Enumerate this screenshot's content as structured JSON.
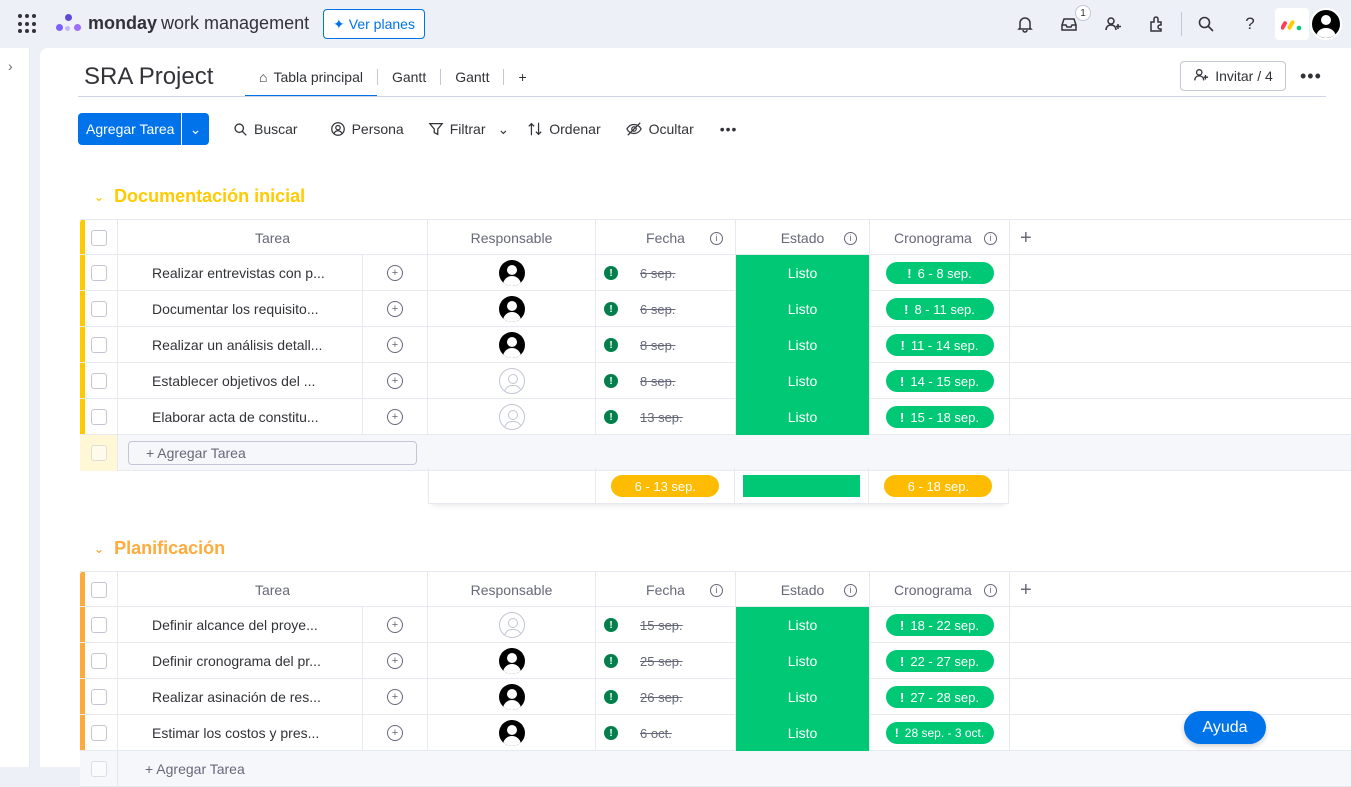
{
  "app": {
    "brand_bold": "monday",
    "brand_rest": "work management",
    "plans_label": "Ver planes",
    "inbox_badge": "1"
  },
  "project": {
    "title": "SRA Project"
  },
  "tabs": [
    {
      "label": "Tabla principal"
    },
    {
      "label": "Gantt"
    },
    {
      "label": "Gantt"
    },
    {
      "label": "+"
    }
  ],
  "invite_label": "Invitar / 4",
  "toolbar": {
    "add_label": "Agregar Tarea",
    "search": "Buscar",
    "person": "Persona",
    "filter": "Filtrar",
    "sort": "Ordenar",
    "hide": "Ocultar"
  },
  "columns": {
    "task": "Tarea",
    "owner": "Responsable",
    "date": "Fecha",
    "status": "Estado",
    "timeline": "Cronograma"
  },
  "groups": [
    {
      "title": "Documentación inicial",
      "color": "#ffcb00",
      "rows": [
        {
          "task": "Realizar entrevistas con p...",
          "owner": "filled",
          "date": "6 sep.",
          "status": "Listo",
          "timeline": "6 - 8 sep."
        },
        {
          "task": "Documentar los requisito...",
          "owner": "filled",
          "date": "6 sep.",
          "status": "Listo",
          "timeline": "8 - 11 sep."
        },
        {
          "task": "Realizar un análisis detall...",
          "owner": "filled",
          "date": "8 sep.",
          "status": "Listo",
          "timeline": "11 - 14 sep."
        },
        {
          "task": "Establecer objetivos del ...",
          "owner": "empty",
          "date": "8 sep.",
          "status": "Listo",
          "timeline": "14 - 15 sep."
        },
        {
          "task": "Elaborar acta de constitu...",
          "owner": "empty",
          "date": "13 sep.",
          "status": "Listo",
          "timeline": "15 - 18 sep."
        }
      ],
      "add_row": "+ Agregar Tarea",
      "summary": {
        "date": "6 - 13 sep.",
        "timeline": "6 - 18 sep."
      }
    },
    {
      "title": "Planificación",
      "color": "#fdab3d",
      "rows": [
        {
          "task": "Definir alcance del proye...",
          "owner": "empty",
          "date": "15 sep.",
          "status": "Listo",
          "timeline": "18 - 22 sep."
        },
        {
          "task": "Definir cronograma del pr...",
          "owner": "filled",
          "date": "25 sep.",
          "status": "Listo",
          "timeline": "22 - 27 sep."
        },
        {
          "task": "Realizar asinación de res...",
          "owner": "filled",
          "date": "26 sep.",
          "status": "Listo",
          "timeline": "27 - 28 sep."
        },
        {
          "task": "Estimar los costos y pres...",
          "owner": "filled",
          "date": "6 oct.",
          "status": "Listo",
          "timeline": "28 sep. - 3 oct."
        }
      ],
      "add_row": "+ Agregar Tarea"
    }
  ],
  "help_label": "Ayuda",
  "colors": {
    "accent": "#0073ea",
    "done": "#00c875",
    "warn": "#037f4c",
    "summary_pill": "#fdbc00"
  },
  "icons": [
    "apps-grid-icon",
    "bell-icon",
    "inbox-icon",
    "invite-user-icon",
    "integrations-icon",
    "search-icon",
    "help-icon",
    "home-icon"
  ]
}
